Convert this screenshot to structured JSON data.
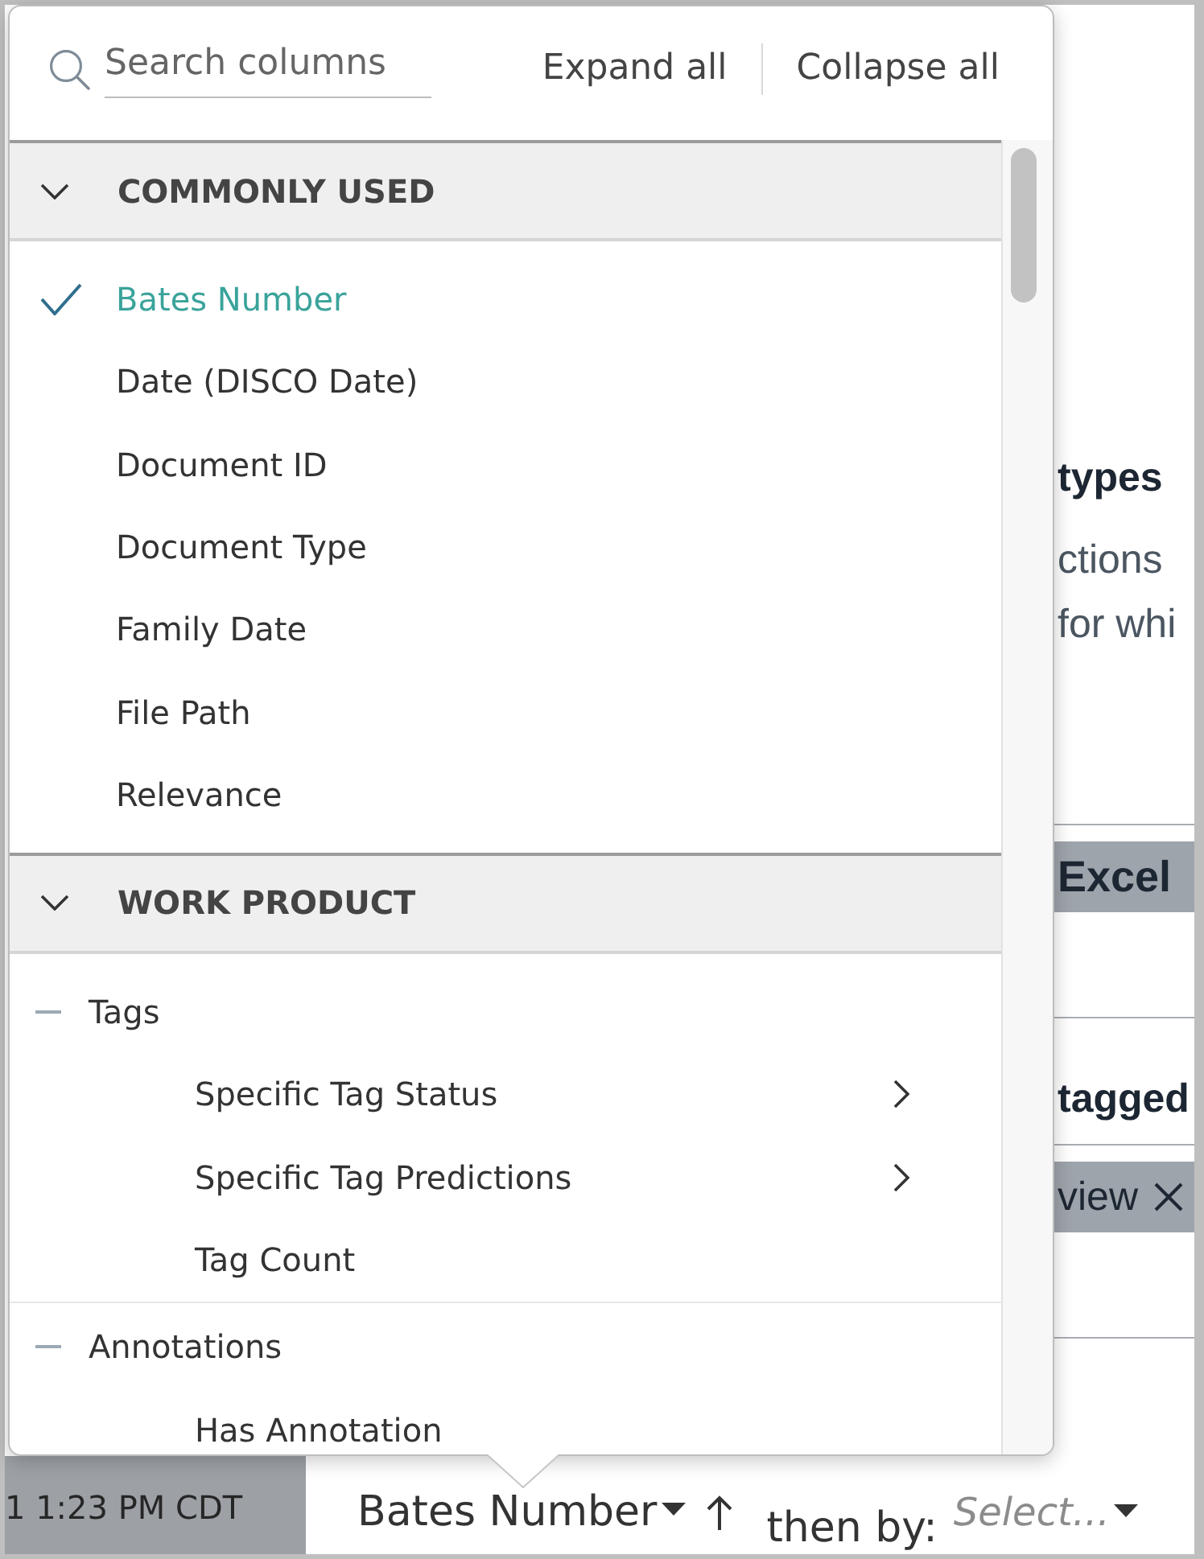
{
  "popup": {
    "search": {
      "placeholder": "Search columns"
    },
    "actions": [
      "Expand all",
      "Collapse all"
    ],
    "sections": [
      {
        "title": "COMMONLY USED",
        "expanded": true,
        "items": [
          {
            "label": "Bates Number",
            "selected": true
          },
          {
            "label": "Date (DISCO Date)",
            "selected": false
          },
          {
            "label": "Document ID",
            "selected": false
          },
          {
            "label": "Document Type",
            "selected": false
          },
          {
            "label": "Family Date",
            "selected": false
          },
          {
            "label": "File Path",
            "selected": false
          },
          {
            "label": "Relevance",
            "selected": false
          }
        ]
      },
      {
        "title": "WORK PRODUCT",
        "expanded": true,
        "groups": [
          {
            "label": "Tags",
            "expanded": true,
            "children": [
              {
                "label": "Specific Tag Status",
                "selected": false,
                "submenu": true
              },
              {
                "label": "Specific Tag Predictions",
                "selected": false,
                "submenu": true
              },
              {
                "label": "Tag Count",
                "selected": false,
                "submenu": false
              }
            ]
          },
          {
            "label": "Annotations",
            "expanded": true,
            "children": [
              {
                "label": "Has Annotation",
                "selected": false,
                "submenu": false
              }
            ]
          }
        ]
      }
    ]
  },
  "background": {
    "blocks": [
      {
        "kind": "heading",
        "text": "types"
      },
      {
        "kind": "text",
        "text": "ctions for whi"
      },
      {
        "kind": "chip",
        "text": "Excel",
        "bold": true,
        "removable": false
      },
      {
        "kind": "heading",
        "text": "tagged"
      },
      {
        "kind": "chip",
        "text": "view",
        "bold": false,
        "removable": true
      }
    ]
  },
  "sort_bar": {
    "timestamp": "1 1:23 PM CDT",
    "field": "Bates Number",
    "ascending": true,
    "then_by_label": "then by:",
    "then_by": {
      "placeholder": "Select..."
    }
  }
}
